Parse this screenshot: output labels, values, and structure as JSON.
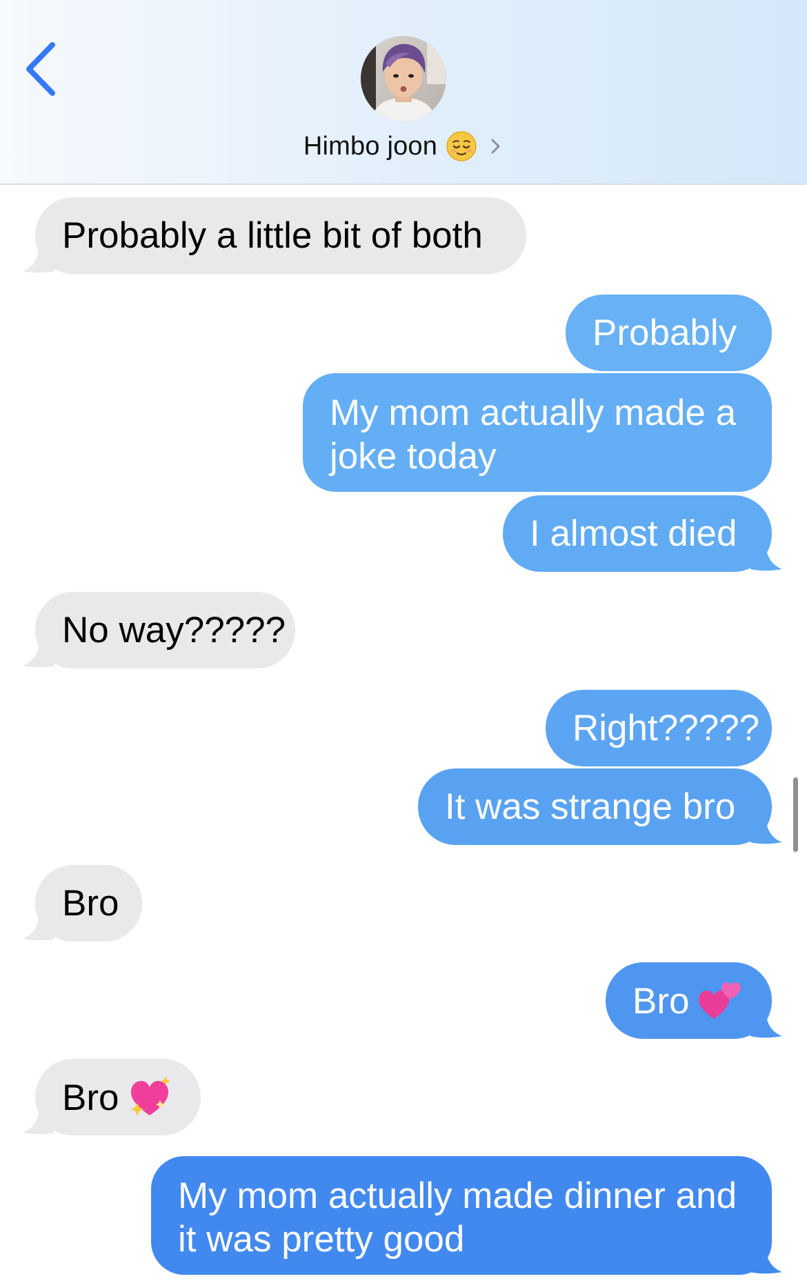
{
  "header": {
    "contact_name": "Himbo joon",
    "contact_emoji": "relieved-face",
    "back_icon": "chevron-left-icon",
    "details_icon": "chevron-right-icon",
    "accent_color": "#3478f6"
  },
  "colors": {
    "incoming_bubble": "#e9e9eb",
    "outgoing_top": "#67b1f4",
    "outgoing_bottom": "#4289ef"
  },
  "messages": [
    {
      "direction": "incoming",
      "text": "Probably a little bit of both"
    },
    {
      "direction": "outgoing",
      "text": "Probably"
    },
    {
      "direction": "outgoing",
      "text": "My mom actually made a joke today"
    },
    {
      "direction": "outgoing",
      "text": "I almost died"
    },
    {
      "direction": "incoming",
      "text": "No way?????"
    },
    {
      "direction": "outgoing",
      "text": "Right?????"
    },
    {
      "direction": "outgoing",
      "text": "It was strange bro"
    },
    {
      "direction": "incoming",
      "text": "Bro"
    },
    {
      "direction": "outgoing",
      "text": "Bro",
      "emoji": "two-hearts"
    },
    {
      "direction": "incoming",
      "text": "Bro",
      "emoji": "sparkling-heart"
    },
    {
      "direction": "outgoing",
      "text": "My mom actually made dinner and it was pretty good"
    }
  ]
}
